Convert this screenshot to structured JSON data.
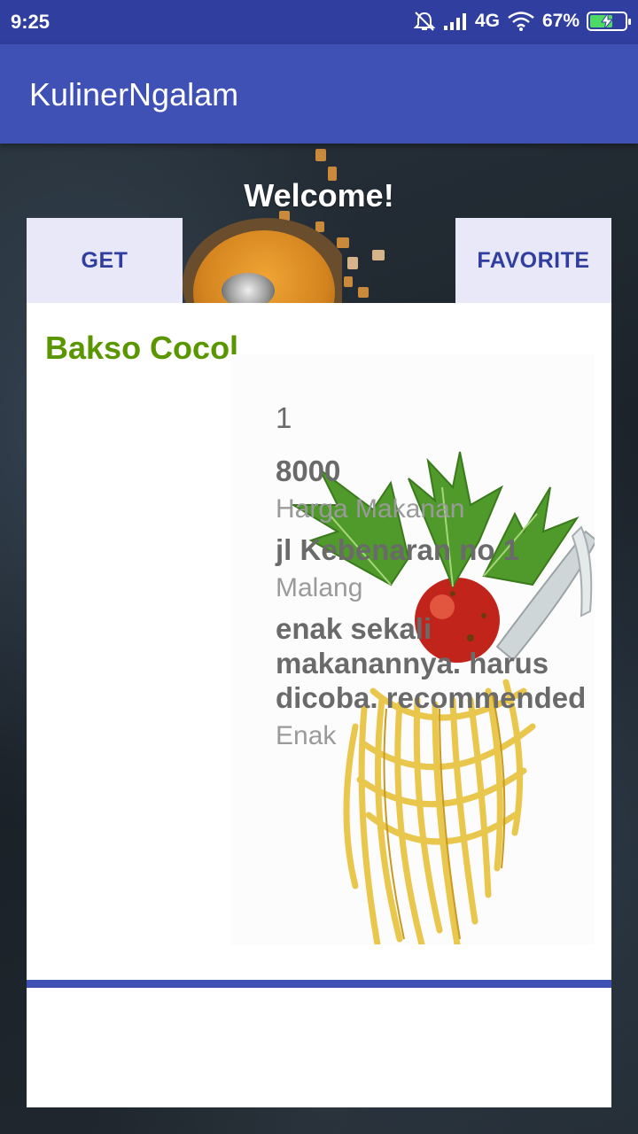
{
  "status_bar": {
    "time": "9:25",
    "network": "4G",
    "battery": "67%",
    "battery_level": 0.67,
    "icons": [
      "mute-icon",
      "signal-icon",
      "wifi-icon",
      "battery-charging-icon"
    ]
  },
  "app_bar": {
    "title": "KulinerNgalam"
  },
  "header": {
    "welcome": "Welcome!",
    "get_label": "GET",
    "favorite_label": "FAVORITE"
  },
  "card": {
    "title": "Bakso Cocol",
    "id": "1",
    "price": "8000",
    "price_label": "Harga Makanan",
    "address": "jl Kebenaran no 1",
    "city": "Malang",
    "review": "enak sekali makanannya. harus dicoba. recommended",
    "rating": "Enak"
  },
  "colors": {
    "primary": "#3f51b5",
    "primary_dark": "#303f9f",
    "title_green": "#5a9600",
    "button_bg": "#e8e8f8"
  }
}
